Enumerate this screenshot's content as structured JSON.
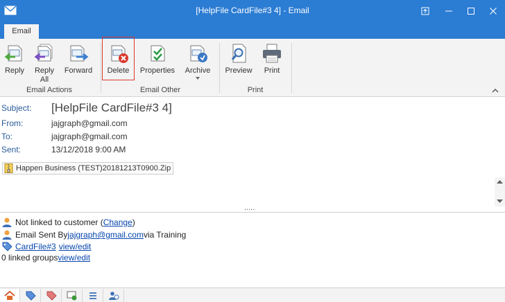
{
  "window": {
    "title": "[HelpFile CardFile#3 4] - Email"
  },
  "tabs": [
    {
      "label": "Email"
    }
  ],
  "ribbon": {
    "buttons": {
      "reply": "Reply",
      "reply_all": "Reply All",
      "forward": "Forward",
      "delete": "Delete",
      "properties": "Properties",
      "archive": "Archive",
      "preview": "Preview",
      "print": "Print"
    },
    "groups": {
      "email_actions": "Email Actions",
      "email_other": "Email Other",
      "print": "Print"
    }
  },
  "header": {
    "subject_label": "Subject:",
    "subject": "[HelpFile CardFile#3 4]",
    "from_label": "From:",
    "from": "jajgraph@gmail.com",
    "to_label": "To:",
    "to": "jajgraph@gmail.com",
    "sent_label": "Sent:",
    "sent": "13/12/2018 9:00 AM",
    "attachment": "Happen Business (TEST)20181213T0900.Zip"
  },
  "splitter_grip": ".....",
  "info": {
    "customer_text": "Not linked to customer (",
    "customer_link": "Change",
    "customer_close": ")",
    "sent_by_text": "Email Sent By ",
    "sent_by_link": "jajgraph@gmail.com",
    "sent_by_suffix": " via Training",
    "cardfile_link": "CardFile#3",
    "view_edit_1": "view/edit",
    "groups_text": "0 linked groups ",
    "view_edit_2": "view/edit"
  },
  "colors": {
    "titlebar": "#2b7cd3",
    "ribbon_bg": "#f3f3f3",
    "label_blue": "#2a5a9a",
    "link": "#0645ad",
    "delete_highlight": "#d9392e"
  },
  "bottom_tabs": [
    "home-icon",
    "tag-blue-icon",
    "tag-red-icon",
    "email-check-icon",
    "list-icon",
    "people-icon"
  ]
}
